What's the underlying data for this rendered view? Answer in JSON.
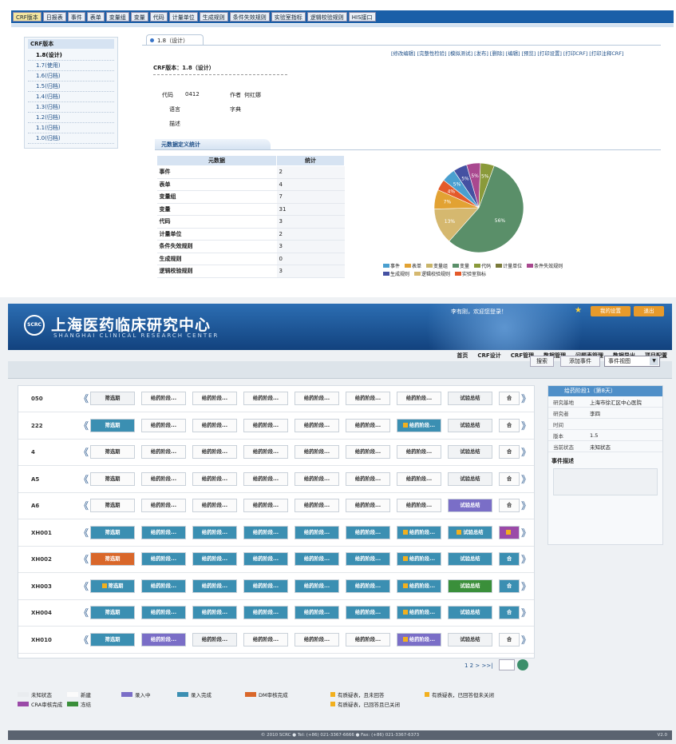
{
  "top": {
    "tabs": [
      "CRF版本",
      "日报表",
      "事件",
      "表单",
      "变量组",
      "变量",
      "代码",
      "计量单位",
      "生成规则",
      "条件失效规则",
      "实验室指标",
      "逻辑校验规则",
      "HIS接口"
    ],
    "tree": {
      "header": "CRF版本",
      "items": [
        "1.8(设计)",
        "1.7(使用)",
        "1.6(归档)",
        "1.5(归档)",
        "1.4(归档)",
        "1.3(归档)",
        "1.2(归档)",
        "1.1(归档)",
        "1.0(归档)"
      ]
    },
    "version_tab": "1.8（设计）",
    "actions": "[修改编辑] [完整性检验] [模拟测试] [发布] [删除] [编辑] [预览] [打印设置] [打印CRF] [打印注释CRF]",
    "crf_version_label": "CRF版本：1.8（设计）",
    "fields": {
      "code_label": "代码",
      "code_value": "0412",
      "author_label": "作者",
      "author_value": "何红娜",
      "language_label": "语言",
      "language_value": "字典",
      "desc_label": "描述"
    },
    "section_title": "元数据定义统计",
    "stats": {
      "headers": [
        "元数据",
        "统计"
      ],
      "rows": [
        [
          "事件",
          "2"
        ],
        [
          "表单",
          "4"
        ],
        [
          "变量组",
          "7"
        ],
        [
          "变量",
          "31"
        ],
        [
          "代码",
          "3"
        ],
        [
          "计量单位",
          "2"
        ],
        [
          "条件失效规则",
          "3"
        ],
        [
          "生成规则",
          "0"
        ],
        [
          "逻辑校验规则",
          "3"
        ]
      ]
    }
  },
  "chart_data": {
    "type": "pie",
    "slices": [
      {
        "label": "变量",
        "value": 56,
        "color": "#5a8f69"
      },
      {
        "label": "计量单位",
        "value": 13,
        "color": "#d5b86f"
      },
      {
        "label": "代码",
        "value": 7,
        "color": "#e2a233"
      },
      {
        "label": "实验室指标",
        "value": 4,
        "color": "#e45a2a"
      },
      {
        "label": "事件",
        "value": 5,
        "color": "#4a9fcf"
      },
      {
        "label": "生成规则",
        "value": 5,
        "color": "#4451a2"
      },
      {
        "label": "条件失效规则",
        "value": 5,
        "color": "#a9488f"
      },
      {
        "label": "变量组",
        "value": 5,
        "color": "#8a9a3a"
      }
    ],
    "data_labels": [
      "56%",
      "13%",
      "7%",
      "4%",
      "5%",
      "5%",
      "5%",
      "5%"
    ],
    "legend": [
      {
        "label": "事件",
        "color": "#4a9fcf"
      },
      {
        "label": "表单",
        "color": "#e2a233"
      },
      {
        "label": "变量组",
        "color": "#c9b56a"
      },
      {
        "label": "变量",
        "color": "#5a8f69"
      },
      {
        "label": "代码",
        "color": "#8a9a3a"
      },
      {
        "label": "计量单位",
        "color": "#7a7a3a"
      },
      {
        "label": "条件失效规则",
        "color": "#a9488f"
      },
      {
        "label": "生成规则",
        "color": "#4451a2"
      },
      {
        "label": "逻辑校验规则",
        "color": "#d5b86f"
      },
      {
        "label": "实验室指标",
        "color": "#e45a2a"
      }
    ],
    "legend_position": "bottom"
  },
  "bottom": {
    "logo_text": "SCRC",
    "brand_cn": "上海医药临床研究中心",
    "brand_en": "SHANGHAI CLINICAL RESEARCH CENTER",
    "welcome": "李有刚，欢迎您登录！",
    "my_settings": "我的设置",
    "logout": "退出",
    "nav": [
      "首页",
      "CRF设计",
      "CRF管理",
      "数据管理",
      "问题表管理",
      "数据导出",
      "项目配置"
    ],
    "search_btn": "搜索",
    "add_event_btn": "添加事件",
    "view_select": "事件视图",
    "subjects": [
      {
        "id": "050",
        "cells": [
          "筛选期",
          "给药阶段...",
          "给药阶段...",
          "给药阶段...",
          "给药阶段...",
          "给药阶段...",
          "给药阶段...",
          "试验总结",
          "合"
        ]
      },
      {
        "id": "222",
        "cells": [
          "筛选期",
          "给药阶段...",
          "给药阶段...",
          "给药阶段...",
          "给药阶段...",
          "给药阶段...",
          "给药阶段...",
          "试验总结",
          "合"
        ]
      },
      {
        "id": "4",
        "cells": [
          "筛选期",
          "给药阶段...",
          "给药阶段...",
          "给药阶段...",
          "给药阶段...",
          "给药阶段...",
          "给药阶段...",
          "试验总结",
          "合"
        ]
      },
      {
        "id": "A5",
        "cells": [
          "筛选期",
          "给药阶段...",
          "给药阶段...",
          "给药阶段...",
          "给药阶段...",
          "给药阶段...",
          "给药阶段...",
          "试验总结",
          "合"
        ]
      },
      {
        "id": "A6",
        "cells": [
          "筛选期",
          "给药阶段...",
          "给药阶段...",
          "给药阶段...",
          "给药阶段...",
          "给药阶段...",
          "给药阶段...",
          "试验总结",
          "合"
        ]
      },
      {
        "id": "XH001",
        "cells": [
          "筛选期",
          "给药阶段...",
          "给药阶段...",
          "给药阶段...",
          "给药阶段...",
          "给药阶段...",
          "给药阶段...",
          "试验总结",
          ""
        ]
      },
      {
        "id": "XH002",
        "cells": [
          "筛选期",
          "给药阶段...",
          "给药阶段...",
          "给药阶段...",
          "给药阶段...",
          "给药阶段...",
          "给药阶段...",
          "试验总结",
          "合"
        ]
      },
      {
        "id": "XH003",
        "cells": [
          "筛选期",
          "给药阶段...",
          "给药阶段...",
          "给药阶段...",
          "给药阶段...",
          "给药阶段...",
          "给药阶段...",
          "试验总结",
          "合"
        ]
      },
      {
        "id": "XH004",
        "cells": [
          "筛选期",
          "给药阶段...",
          "给药阶段...",
          "给药阶段...",
          "给药阶段...",
          "给药阶段...",
          "给药阶段...",
          "试验总结",
          "合"
        ]
      },
      {
        "id": "XH010",
        "cells": [
          "筛选期",
          "给药阶段...",
          "给药阶段...",
          "给药阶段...",
          "给药阶段...",
          "给药阶段...",
          "给药阶段...",
          "试验总结",
          "合"
        ]
      }
    ],
    "pager": "1 2 > >>|",
    "panel": {
      "title": "给药阶段1（第8天）",
      "rows": [
        {
          "k": "研究基地",
          "v": "上海市徐汇区中心医院"
        },
        {
          "k": "研究者",
          "v": "李四"
        },
        {
          "k": "时间",
          "v": ""
        },
        {
          "k": "版本",
          "v": "1.5"
        },
        {
          "k": "当前状态",
          "v": "未知状态"
        }
      ],
      "event_desc": "事件描述"
    },
    "keys": [
      {
        "label": "未知状态",
        "color": "#e9ecef"
      },
      {
        "label": "新建",
        "color": "#fbfbfb"
      },
      {
        "label": "录入中",
        "color": "#7a6ec7"
      },
      {
        "label": "录入完成",
        "color": "#3b8fb2"
      },
      {
        "label": "DM审核完成",
        "color": "#d9672a"
      },
      {
        "label": "CRA审核完成",
        "color": "#9b4aa8"
      },
      {
        "label": "冻结",
        "color": "#3a8f3a"
      },
      {
        "label": "有质疑表，且未回答",
        "color": "#f2b01e"
      },
      {
        "label": "有质疑表，已回答且已关闭",
        "color": "#f2b01e"
      },
      {
        "label": "有质疑表，已回答但未关闭",
        "color": "#f2b01e"
      }
    ],
    "footer": "© 2010 SCRC ● Tel: (+86) 021-3367-6666 ● Fax: (+86) 021-3367-6373",
    "version": "V2.0"
  }
}
